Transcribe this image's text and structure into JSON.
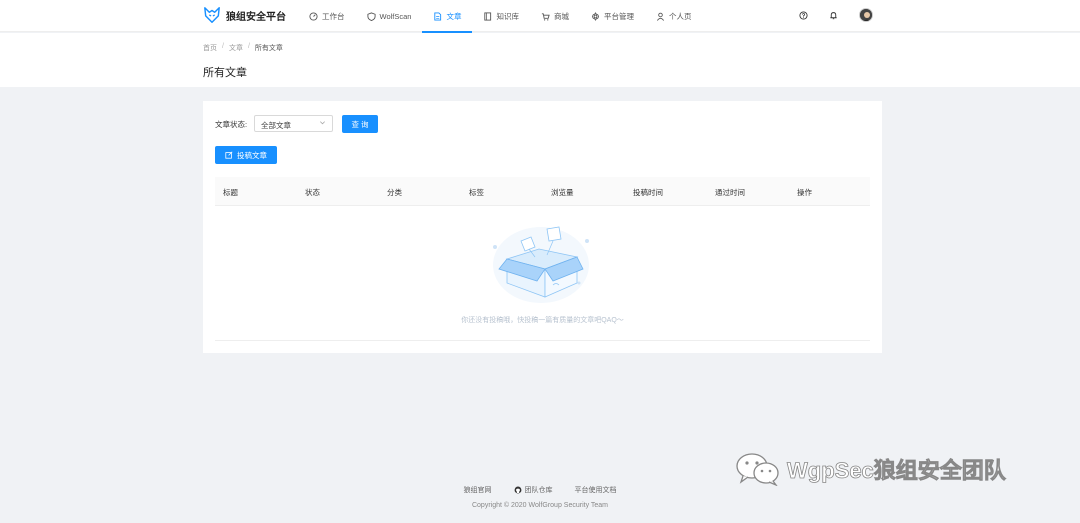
{
  "brand": {
    "name": "狼组安全平台",
    "accent": "#1890ff"
  },
  "nav": {
    "items": [
      {
        "label": "工作台",
        "icon": "dashboard-icon",
        "active": false
      },
      {
        "label": "WolfScan",
        "icon": "shield-icon",
        "active": false
      },
      {
        "label": "文章",
        "icon": "document-icon",
        "active": true
      },
      {
        "label": "知识库",
        "icon": "book-icon",
        "active": false
      },
      {
        "label": "商城",
        "icon": "cart-icon",
        "active": false
      },
      {
        "label": "平台管理",
        "icon": "settings-icon",
        "active": false
      },
      {
        "label": "个人页",
        "icon": "user-icon",
        "active": false
      }
    ]
  },
  "breadcrumb": {
    "home": "首页",
    "section": "文章",
    "current": "所有文章"
  },
  "page": {
    "title": "所有文章"
  },
  "filter": {
    "label": "文章状态:",
    "selected": "全部文章",
    "query_button": "查 询"
  },
  "actions": {
    "submit_button": "投稿文章"
  },
  "table": {
    "columns": [
      "标题",
      "状态",
      "分类",
      "标签",
      "浏览量",
      "投稿时间",
      "通过时间",
      "操作"
    ],
    "rows": [],
    "empty_text": "你还没有投稿哦，快投稿一篇有质量的文章吧QAQ～"
  },
  "footer": {
    "links": [
      "狼组官网",
      "团队仓库",
      "平台使用文档"
    ],
    "copyright": "Copyright © 2020 WolfGroup Security Team"
  },
  "watermark": {
    "text": "WgpSec狼组安全团队"
  }
}
